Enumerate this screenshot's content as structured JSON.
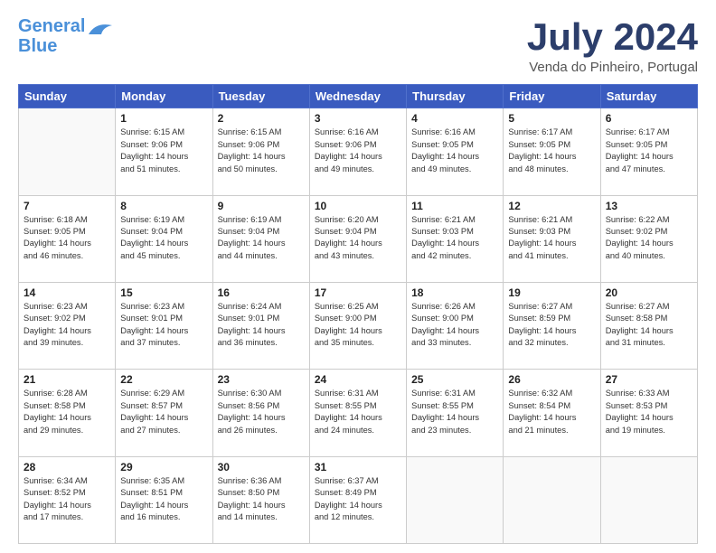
{
  "header": {
    "logo_line1": "General",
    "logo_line2": "Blue",
    "month": "July 2024",
    "location": "Venda do Pinheiro, Portugal"
  },
  "weekdays": [
    "Sunday",
    "Monday",
    "Tuesday",
    "Wednesday",
    "Thursday",
    "Friday",
    "Saturday"
  ],
  "weeks": [
    [
      {
        "day": "",
        "info": ""
      },
      {
        "day": "1",
        "info": "Sunrise: 6:15 AM\nSunset: 9:06 PM\nDaylight: 14 hours\nand 51 minutes."
      },
      {
        "day": "2",
        "info": "Sunrise: 6:15 AM\nSunset: 9:06 PM\nDaylight: 14 hours\nand 50 minutes."
      },
      {
        "day": "3",
        "info": "Sunrise: 6:16 AM\nSunset: 9:06 PM\nDaylight: 14 hours\nand 49 minutes."
      },
      {
        "day": "4",
        "info": "Sunrise: 6:16 AM\nSunset: 9:05 PM\nDaylight: 14 hours\nand 49 minutes."
      },
      {
        "day": "5",
        "info": "Sunrise: 6:17 AM\nSunset: 9:05 PM\nDaylight: 14 hours\nand 48 minutes."
      },
      {
        "day": "6",
        "info": "Sunrise: 6:17 AM\nSunset: 9:05 PM\nDaylight: 14 hours\nand 47 minutes."
      }
    ],
    [
      {
        "day": "7",
        "info": "Sunrise: 6:18 AM\nSunset: 9:05 PM\nDaylight: 14 hours\nand 46 minutes."
      },
      {
        "day": "8",
        "info": "Sunrise: 6:19 AM\nSunset: 9:04 PM\nDaylight: 14 hours\nand 45 minutes."
      },
      {
        "day": "9",
        "info": "Sunrise: 6:19 AM\nSunset: 9:04 PM\nDaylight: 14 hours\nand 44 minutes."
      },
      {
        "day": "10",
        "info": "Sunrise: 6:20 AM\nSunset: 9:04 PM\nDaylight: 14 hours\nand 43 minutes."
      },
      {
        "day": "11",
        "info": "Sunrise: 6:21 AM\nSunset: 9:03 PM\nDaylight: 14 hours\nand 42 minutes."
      },
      {
        "day": "12",
        "info": "Sunrise: 6:21 AM\nSunset: 9:03 PM\nDaylight: 14 hours\nand 41 minutes."
      },
      {
        "day": "13",
        "info": "Sunrise: 6:22 AM\nSunset: 9:02 PM\nDaylight: 14 hours\nand 40 minutes."
      }
    ],
    [
      {
        "day": "14",
        "info": "Sunrise: 6:23 AM\nSunset: 9:02 PM\nDaylight: 14 hours\nand 39 minutes."
      },
      {
        "day": "15",
        "info": "Sunrise: 6:23 AM\nSunset: 9:01 PM\nDaylight: 14 hours\nand 37 minutes."
      },
      {
        "day": "16",
        "info": "Sunrise: 6:24 AM\nSunset: 9:01 PM\nDaylight: 14 hours\nand 36 minutes."
      },
      {
        "day": "17",
        "info": "Sunrise: 6:25 AM\nSunset: 9:00 PM\nDaylight: 14 hours\nand 35 minutes."
      },
      {
        "day": "18",
        "info": "Sunrise: 6:26 AM\nSunset: 9:00 PM\nDaylight: 14 hours\nand 33 minutes."
      },
      {
        "day": "19",
        "info": "Sunrise: 6:27 AM\nSunset: 8:59 PM\nDaylight: 14 hours\nand 32 minutes."
      },
      {
        "day": "20",
        "info": "Sunrise: 6:27 AM\nSunset: 8:58 PM\nDaylight: 14 hours\nand 31 minutes."
      }
    ],
    [
      {
        "day": "21",
        "info": "Sunrise: 6:28 AM\nSunset: 8:58 PM\nDaylight: 14 hours\nand 29 minutes."
      },
      {
        "day": "22",
        "info": "Sunrise: 6:29 AM\nSunset: 8:57 PM\nDaylight: 14 hours\nand 27 minutes."
      },
      {
        "day": "23",
        "info": "Sunrise: 6:30 AM\nSunset: 8:56 PM\nDaylight: 14 hours\nand 26 minutes."
      },
      {
        "day": "24",
        "info": "Sunrise: 6:31 AM\nSunset: 8:55 PM\nDaylight: 14 hours\nand 24 minutes."
      },
      {
        "day": "25",
        "info": "Sunrise: 6:31 AM\nSunset: 8:55 PM\nDaylight: 14 hours\nand 23 minutes."
      },
      {
        "day": "26",
        "info": "Sunrise: 6:32 AM\nSunset: 8:54 PM\nDaylight: 14 hours\nand 21 minutes."
      },
      {
        "day": "27",
        "info": "Sunrise: 6:33 AM\nSunset: 8:53 PM\nDaylight: 14 hours\nand 19 minutes."
      }
    ],
    [
      {
        "day": "28",
        "info": "Sunrise: 6:34 AM\nSunset: 8:52 PM\nDaylight: 14 hours\nand 17 minutes."
      },
      {
        "day": "29",
        "info": "Sunrise: 6:35 AM\nSunset: 8:51 PM\nDaylight: 14 hours\nand 16 minutes."
      },
      {
        "day": "30",
        "info": "Sunrise: 6:36 AM\nSunset: 8:50 PM\nDaylight: 14 hours\nand 14 minutes."
      },
      {
        "day": "31",
        "info": "Sunrise: 6:37 AM\nSunset: 8:49 PM\nDaylight: 14 hours\nand 12 minutes."
      },
      {
        "day": "",
        "info": ""
      },
      {
        "day": "",
        "info": ""
      },
      {
        "day": "",
        "info": ""
      }
    ]
  ]
}
